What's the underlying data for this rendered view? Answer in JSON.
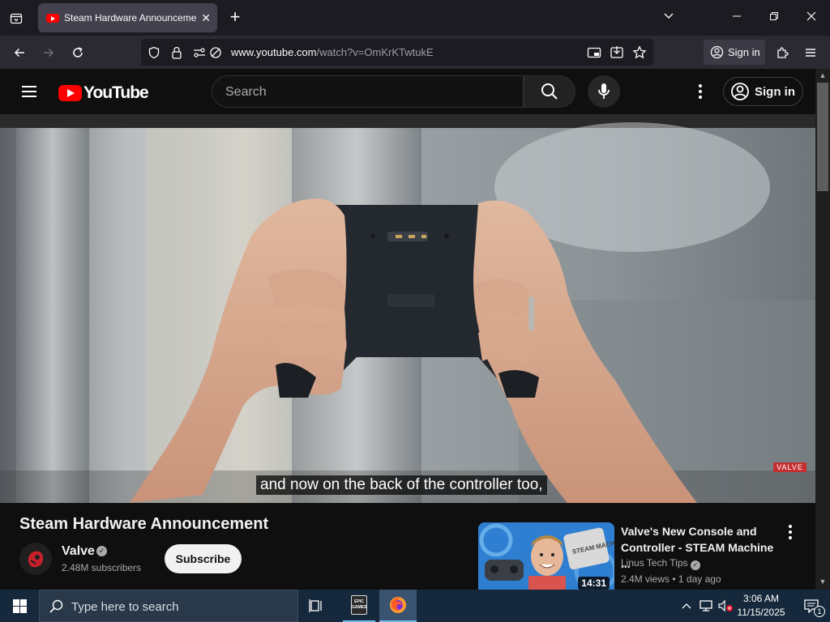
{
  "browser": {
    "tab_title": "Steam Hardware Announcement",
    "url_domain": "www.youtube.com",
    "url_path": "/watch?v=OmKrKTwtukE",
    "sign_in_label": "Sign in"
  },
  "youtube": {
    "logo_text": "YouTube",
    "search_placeholder": "Search",
    "sign_in_label": "Sign in",
    "caption_text": "and now on the back of the controller too,",
    "watermark": "VALVE",
    "video_title": "Steam Hardware Announcement",
    "channel": {
      "name": "Valve",
      "subscribers": "2.48M subscribers",
      "subscribe_label": "Subscribe"
    },
    "recommendation": {
      "title": "Valve's New Console and Controller - STEAM Machine ...",
      "channel": "Linus Tech Tips",
      "meta": "2.4M views • 1 day ago",
      "duration": "14:31",
      "thumb_text": "STEAM MACHINE"
    }
  },
  "taskbar": {
    "search_placeholder": "Type here to search",
    "epic_label": "EPIC GAMES",
    "time": "3:06 AM",
    "date": "11/15/2025",
    "notification_count": "1"
  }
}
